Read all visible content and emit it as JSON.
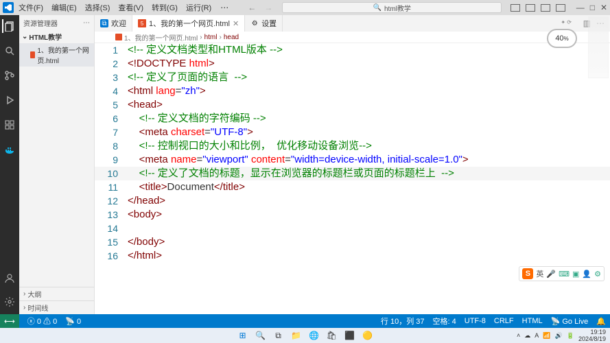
{
  "menubar": {
    "items": [
      "文件(F)",
      "编辑(E)",
      "选择(S)",
      "查看(V)",
      "转到(G)",
      "运行(R)"
    ],
    "search": "html教学"
  },
  "sidebar": {
    "title": "资源管理器",
    "folder": "HTML教学",
    "file": "1、我的第一个网页.html",
    "outline": "大纲",
    "timeline": "时间线"
  },
  "tabs": {
    "welcome": "欢迎",
    "file": "1、我的第一个网页.html",
    "settings": "设置"
  },
  "breadcrumbs": {
    "file": "1、我的第一个网页.html",
    "path1": "html",
    "path2": "head"
  },
  "badge": {
    "percent": "40",
    "sub": "%"
  },
  "code": {
    "lines": [
      {
        "n": "1",
        "html": "<span class='c-comment'>&lt;!-- 定义文档类型和HTML版本 --&gt;</span>"
      },
      {
        "n": "2",
        "html": "<span class='c-doctype'>&lt;!DOCTYPE</span> <span class='c-attr'>html</span><span class='c-doctype'>&gt;</span>"
      },
      {
        "n": "3",
        "html": "<span class='c-comment'>&lt;!-- 定义了页面的语言  --&gt;</span>"
      },
      {
        "n": "4",
        "html": "<span class='c-tag'>&lt;html</span> <span class='c-attr'>lang</span>=<span class='c-val'>\"zh\"</span><span class='c-tag'>&gt;</span>"
      },
      {
        "n": "5",
        "html": "<span class='c-tag'>&lt;head&gt;</span>"
      },
      {
        "n": "6",
        "html": "    <span class='c-comment'>&lt;!-- 定义文档的字符编码 --&gt;</span>"
      },
      {
        "n": "7",
        "html": "    <span class='c-tag'>&lt;meta</span> <span class='c-attr'>charset</span>=<span class='c-val'>\"UTF-8\"</span><span class='c-tag'>&gt;</span>"
      },
      {
        "n": "8",
        "html": "    <span class='c-comment'>&lt;!-- 控制视口的大小和比例，  优化移动设备浏览--&gt;</span>"
      },
      {
        "n": "9",
        "html": "    <span class='c-tag'>&lt;meta</span> <span class='c-attr'>name</span>=<span class='c-val'>\"viewport\"</span> <span class='c-attr'>content</span>=<span class='c-val'>\"width=device-width, initial-scale=1.0\"</span><span class='c-tag'>&gt;</span>"
      },
      {
        "n": "10",
        "html": "    <span class='c-comment'>&lt;!-- 定义了文档的标题，显示在浏览器的标题栏或页面的标题栏上  --&gt;</span>",
        "hl": true
      },
      {
        "n": "11",
        "html": "    <span class='c-tag'>&lt;title&gt;</span>Document<span class='c-tag'>&lt;/title&gt;</span>"
      },
      {
        "n": "12",
        "html": "<span class='c-tag'>&lt;/head&gt;</span>"
      },
      {
        "n": "13",
        "html": "<span class='c-tag'>&lt;body&gt;</span>"
      },
      {
        "n": "14",
        "html": ""
      },
      {
        "n": "15",
        "html": "<span class='c-tag'>&lt;/body&gt;</span>"
      },
      {
        "n": "16",
        "html": "<span class='c-tag'>&lt;/html&gt;</span>"
      }
    ]
  },
  "ime": {
    "lang": "英"
  },
  "status": {
    "errors": "0",
    "warnings": "0",
    "port": "0",
    "cursor": "行 10，列 37",
    "spaces": "空格: 4",
    "encoding": "UTF-8",
    "eol": "CRLF",
    "lang": "HTML",
    "golive": "Go Live"
  },
  "taskbar": {
    "time": "19:19",
    "date": "2024/8/19"
  }
}
